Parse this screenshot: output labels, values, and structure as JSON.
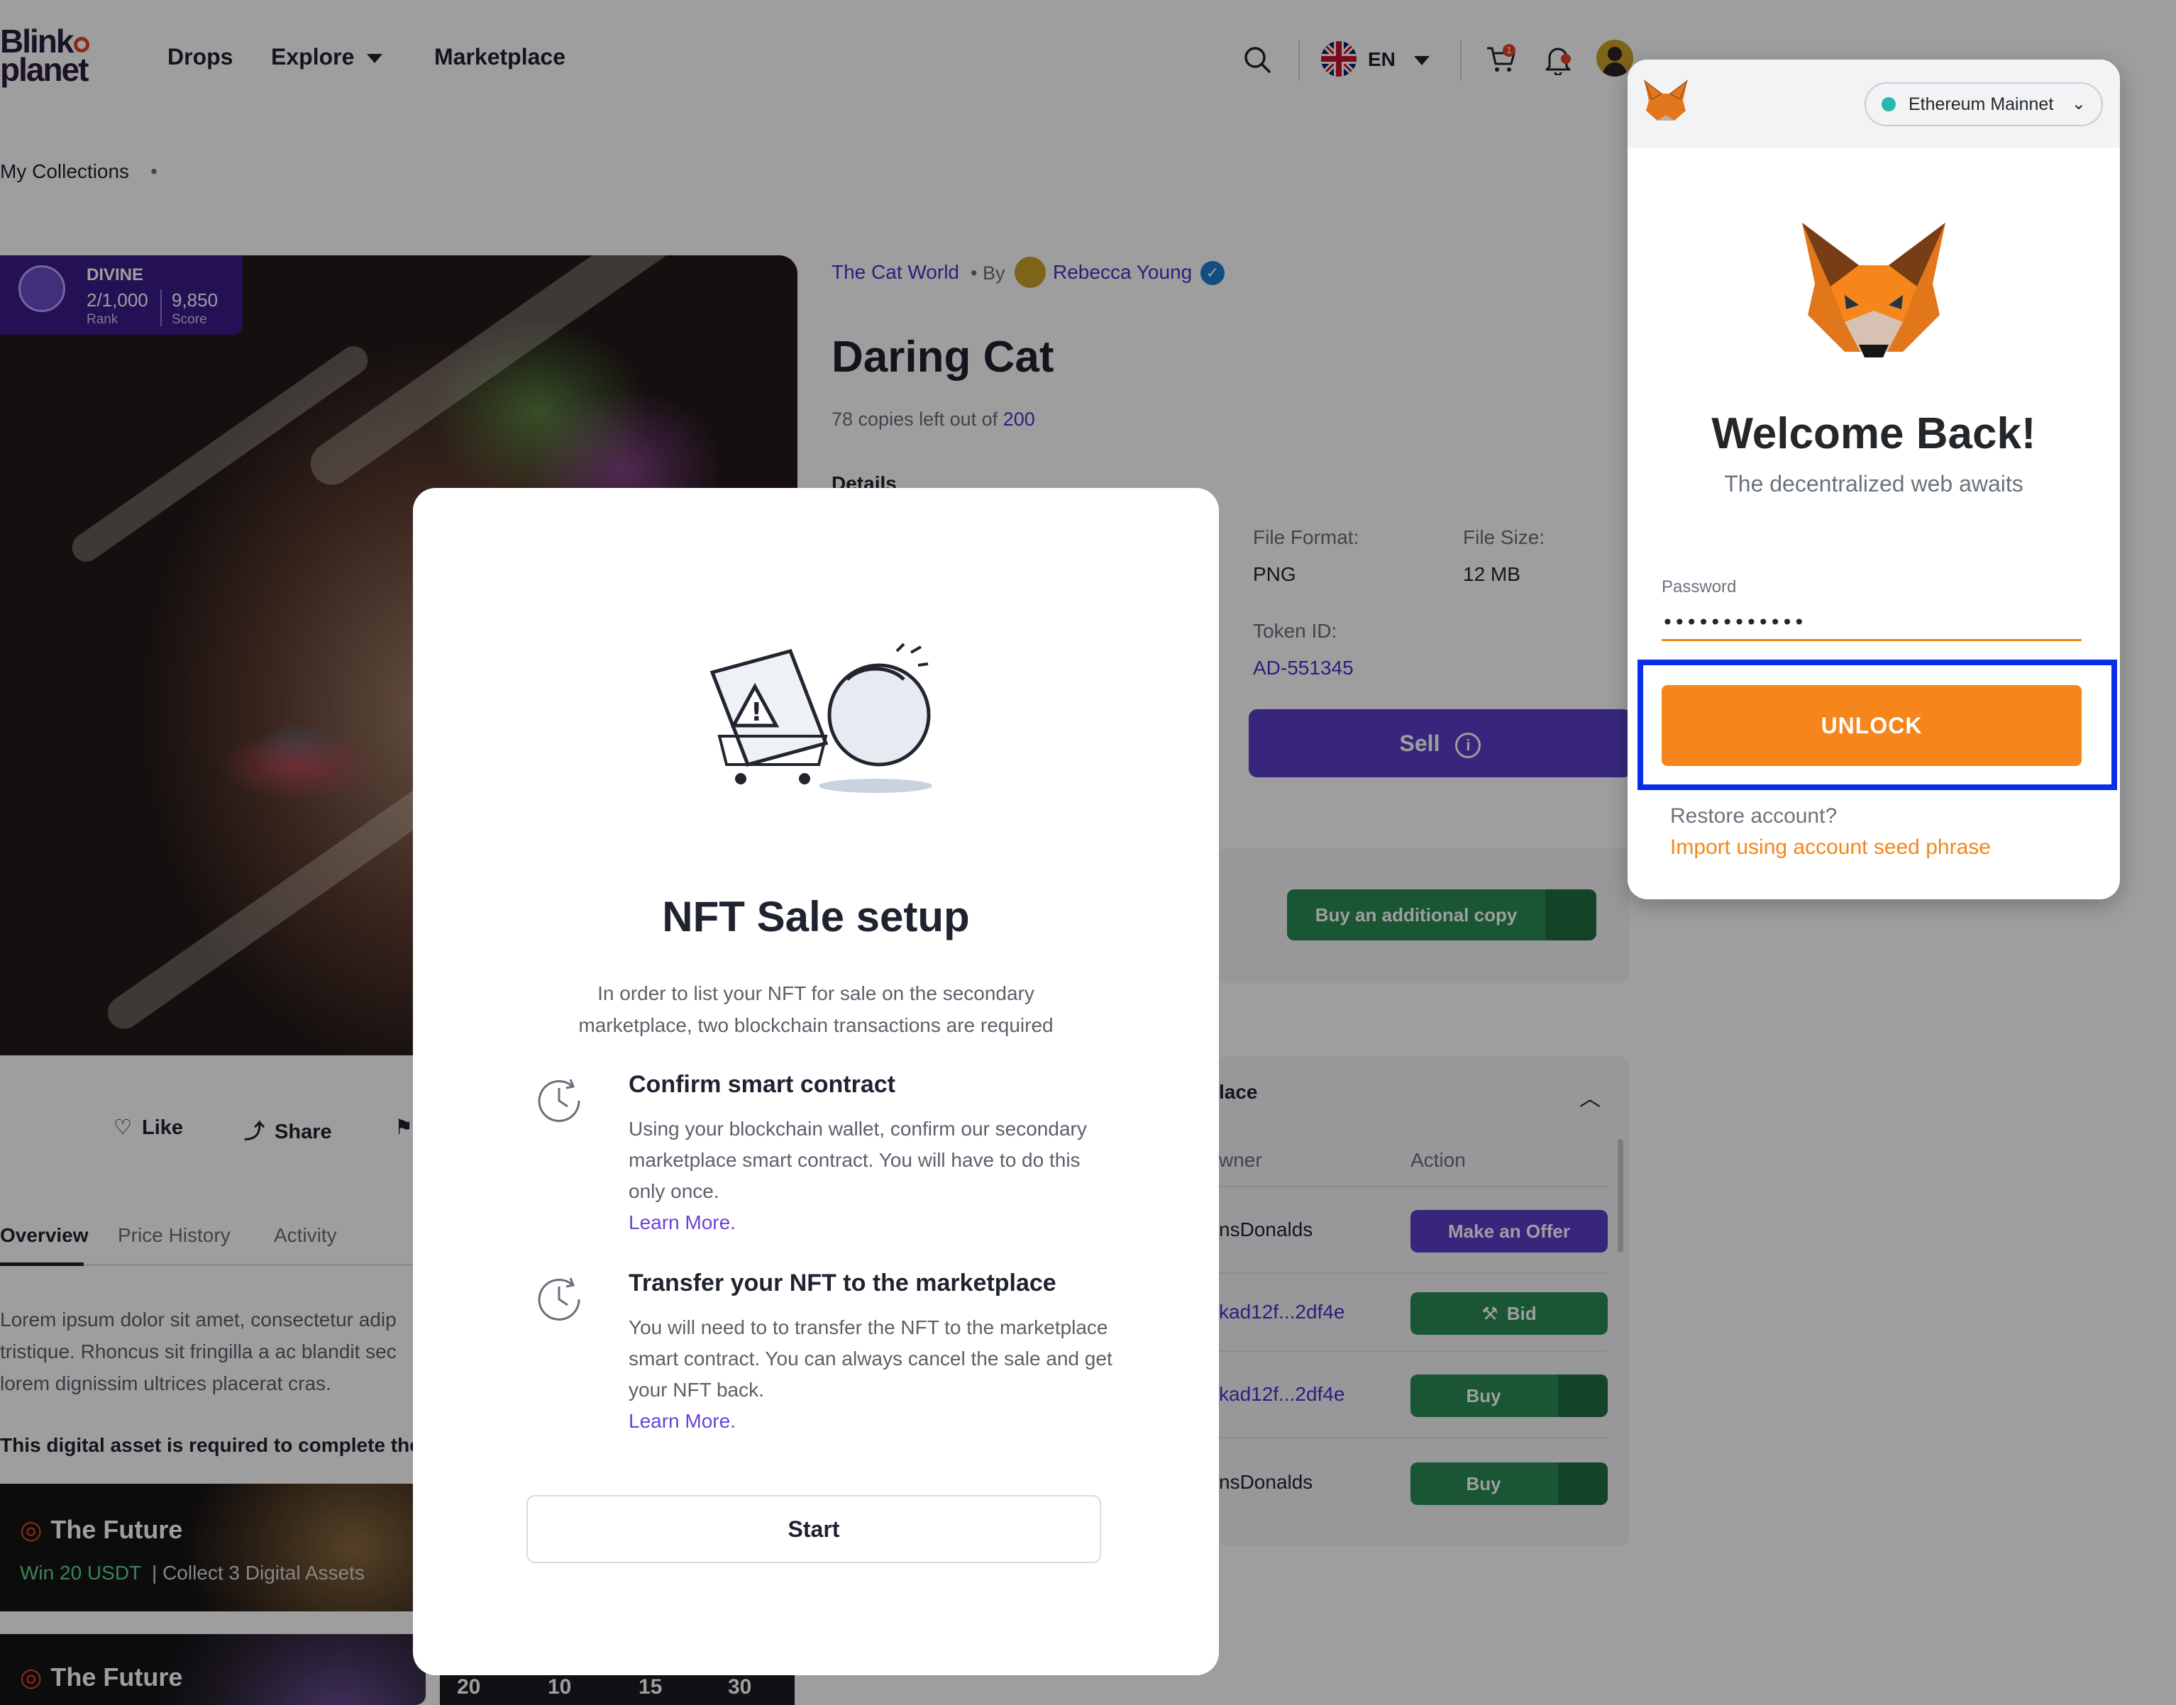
{
  "header": {
    "logo_text_line1": "Blink",
    "logo_text_line2": "planet",
    "nav": [
      "Drops",
      "Explore",
      "Marketplace"
    ],
    "language": "EN",
    "cart_badge": "1"
  },
  "breadcrumb": "My Collections",
  "rank_chip": {
    "tier": "DIVINE",
    "rank_value": "2/1,000",
    "rank_label": "Rank",
    "score_value": "9,850",
    "score_label": "Score"
  },
  "nft": {
    "collection": "The Cat World",
    "by": "• By",
    "creator": "Rebecca Young",
    "title": "Daring Cat",
    "copies_prefix": "78 copies left out of",
    "copies_total": "200",
    "details_label": "Details",
    "file_format_label": "File Format:",
    "file_format": "PNG",
    "file_size_label": "File Size:",
    "file_size": "12 MB",
    "token_id_label": "Token ID:",
    "token_id": "AD-551345",
    "sell_label": "Sell",
    "buy_copy_label": "Buy an additional copy"
  },
  "actions": {
    "like": "Like",
    "share": "Share"
  },
  "tabs": [
    "Overview",
    "Price History",
    "Activity"
  ],
  "overview": {
    "line1": "Lorem ipsum dolor sit amet, consectetur adip",
    "line2": "tristique. Rhoncus sit fringilla a ac blandit sec",
    "line3": "lorem dignissim ultrices placerat cras.",
    "required_text": "This digital asset is required to complete the"
  },
  "quests": [
    {
      "title": "The Future",
      "reward": "Win 20 USDT",
      "task": "Collect 3 Digital Assets"
    },
    {
      "title": "The Future"
    }
  ],
  "timer": [
    "20",
    "10",
    "15",
    "30"
  ],
  "marketplace_table": {
    "title_fragment": "lace",
    "owner_header": "wner",
    "action_header": "Action",
    "rows": [
      {
        "owner": "nsDonalds",
        "action": "Make an Offer"
      },
      {
        "owner": "kad12f...2df4e",
        "action": "Bid"
      },
      {
        "owner": "kad12f...2df4e",
        "action": "Buy"
      },
      {
        "owner": "nsDonalds",
        "action": "Buy"
      }
    ]
  },
  "modal": {
    "title": "NFT Sale setup",
    "lead": "In order to list your NFT for sale on the secondary marketplace, two blockchain transactions are required",
    "steps": [
      {
        "title": "Confirm smart contract",
        "body": "Using your blockchain wallet, confirm our secondary marketplace smart contract. You will have to do this only once.",
        "link": "Learn More."
      },
      {
        "title": "Transfer your NFT to the marketplace",
        "body": "You will need to to transfer the NFT to the marketplace smart contract. You can always cancel the sale and get your NFT back.",
        "link": "Learn More."
      }
    ],
    "start_label": "Start"
  },
  "metamask": {
    "network": "Ethereum Mainnet",
    "welcome": "Welcome Back!",
    "tagline": "The decentralized web awaits",
    "password_label": "Password",
    "password_value": "••••••••••••",
    "unlock_label": "UNLOCK",
    "restore": "Restore account?",
    "import": "Import using account seed phrase"
  },
  "colors": {
    "metamask_orange": "#f6851b",
    "highlight_box": "#0a2ee8",
    "brand_purple": "#5a3ec8",
    "buy_green": "#2a8a55"
  }
}
